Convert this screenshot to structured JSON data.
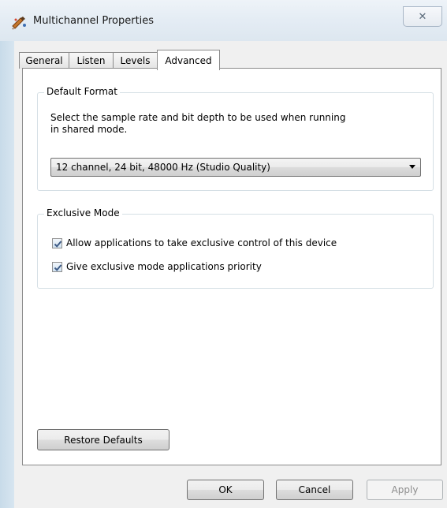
{
  "window": {
    "title": "Multichannel Properties",
    "close_glyph": "✕",
    "icon": "speaker-icon"
  },
  "tabs": [
    {
      "label": "General"
    },
    {
      "label": "Listen"
    },
    {
      "label": "Levels"
    },
    {
      "label": "Advanced",
      "active": true
    }
  ],
  "default_format": {
    "title": "Default Format",
    "description_line1": "Select the sample rate and bit depth to be used when running",
    "description_line2": "in shared mode.",
    "selected_format": "12 channel, 24 bit, 48000 Hz (Studio Quality)"
  },
  "exclusive_mode": {
    "title": "Exclusive Mode",
    "allow_exclusive_label": "Allow applications to take exclusive control of this device",
    "allow_exclusive_checked": true,
    "priority_label": "Give exclusive mode applications priority",
    "priority_checked": true
  },
  "buttons": {
    "restore_defaults": "Restore Defaults",
    "ok": "OK",
    "cancel": "Cancel",
    "apply": "Apply"
  },
  "colors": {
    "check_mark": "#3d5a86"
  }
}
